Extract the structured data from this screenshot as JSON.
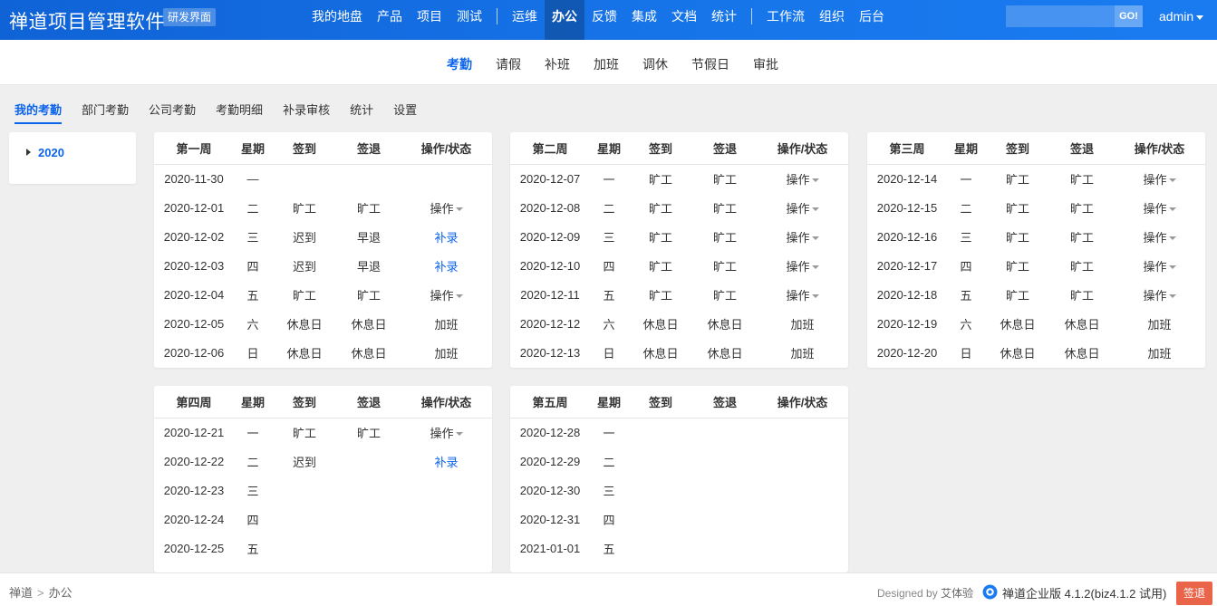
{
  "header": {
    "brand": "禅道项目管理软件",
    "badge": "研发界面",
    "nav_group1": [
      "我的地盘",
      "产品",
      "项目",
      "测试"
    ],
    "nav_group2": [
      "运维",
      "办公",
      "反馈",
      "集成",
      "文档",
      "统计"
    ],
    "nav_group3": [
      "工作流",
      "组织",
      "后台"
    ],
    "active_nav": "办公",
    "search": {
      "placeholder": "",
      "button": "GO!"
    },
    "user": "admin"
  },
  "subnav": {
    "items": [
      "考勤",
      "请假",
      "补班",
      "加班",
      "调休",
      "节假日",
      "审批"
    ],
    "active": "考勤"
  },
  "tabs": {
    "items": [
      "我的考勤",
      "部门考勤",
      "公司考勤",
      "考勤明细",
      "补录审核",
      "统计",
      "设置"
    ],
    "active": "我的考勤"
  },
  "year_list": {
    "year": "2020"
  },
  "colors": {
    "absent": "#f1a325",
    "late": "#f05c45",
    "early_leave": "#e5572d",
    "rest": "#3280fc",
    "link": "#0c64eb",
    "primary": "#0c64eb",
    "danger": "#ea644a"
  },
  "table_headers": {
    "day": "星期",
    "sign_in": "签到",
    "sign_out": "签退",
    "action": "操作/状态"
  },
  "weeks": [
    {
      "title": "第一周",
      "rows": [
        {
          "date": "2020-11-30",
          "day": "一",
          "in": "",
          "out": "",
          "action": "",
          "muted": true
        },
        {
          "date": "2020-12-01",
          "day": "二",
          "in": "旷工",
          "out": "旷工",
          "action": "操作"
        },
        {
          "date": "2020-12-02",
          "day": "三",
          "in": "迟到",
          "out": "早退",
          "action": "补录"
        },
        {
          "date": "2020-12-03",
          "day": "四",
          "in": "迟到",
          "out": "早退",
          "action": "补录"
        },
        {
          "date": "2020-12-04",
          "day": "五",
          "in": "旷工",
          "out": "旷工",
          "action": "操作"
        },
        {
          "date": "2020-12-05",
          "day": "六",
          "in": "休息日",
          "out": "休息日",
          "action": "加班"
        },
        {
          "date": "2020-12-06",
          "day": "日",
          "in": "休息日",
          "out": "休息日",
          "action": "加班"
        }
      ]
    },
    {
      "title": "第二周",
      "rows": [
        {
          "date": "2020-12-07",
          "day": "一",
          "in": "旷工",
          "out": "旷工",
          "action": "操作"
        },
        {
          "date": "2020-12-08",
          "day": "二",
          "in": "旷工",
          "out": "旷工",
          "action": "操作"
        },
        {
          "date": "2020-12-09",
          "day": "三",
          "in": "旷工",
          "out": "旷工",
          "action": "操作"
        },
        {
          "date": "2020-12-10",
          "day": "四",
          "in": "旷工",
          "out": "旷工",
          "action": "操作"
        },
        {
          "date": "2020-12-11",
          "day": "五",
          "in": "旷工",
          "out": "旷工",
          "action": "操作"
        },
        {
          "date": "2020-12-12",
          "day": "六",
          "in": "休息日",
          "out": "休息日",
          "action": "加班"
        },
        {
          "date": "2020-12-13",
          "day": "日",
          "in": "休息日",
          "out": "休息日",
          "action": "加班"
        }
      ]
    },
    {
      "title": "第三周",
      "rows": [
        {
          "date": "2020-12-14",
          "day": "一",
          "in": "旷工",
          "out": "旷工",
          "action": "操作"
        },
        {
          "date": "2020-12-15",
          "day": "二",
          "in": "旷工",
          "out": "旷工",
          "action": "操作"
        },
        {
          "date": "2020-12-16",
          "day": "三",
          "in": "旷工",
          "out": "旷工",
          "action": "操作"
        },
        {
          "date": "2020-12-17",
          "day": "四",
          "in": "旷工",
          "out": "旷工",
          "action": "操作"
        },
        {
          "date": "2020-12-18",
          "day": "五",
          "in": "旷工",
          "out": "旷工",
          "action": "操作"
        },
        {
          "date": "2020-12-19",
          "day": "六",
          "in": "休息日",
          "out": "休息日",
          "action": "加班"
        },
        {
          "date": "2020-12-20",
          "day": "日",
          "in": "休息日",
          "out": "休息日",
          "action": "加班"
        }
      ]
    },
    {
      "title": "第四周",
      "rows": [
        {
          "date": "2020-12-21",
          "day": "一",
          "in": "旷工",
          "out": "旷工",
          "action": "操作"
        },
        {
          "date": "2020-12-22",
          "day": "二",
          "in": "迟到",
          "out": "",
          "action": "补录"
        },
        {
          "date": "2020-12-23",
          "day": "三",
          "in": "",
          "out": "",
          "action": ""
        },
        {
          "date": "2020-12-24",
          "day": "四",
          "in": "",
          "out": "",
          "action": ""
        },
        {
          "date": "2020-12-25",
          "day": "五",
          "in": "",
          "out": "",
          "action": ""
        }
      ]
    },
    {
      "title": "第五周",
      "rows": [
        {
          "date": "2020-12-28",
          "day": "一",
          "in": "",
          "out": "",
          "action": ""
        },
        {
          "date": "2020-12-29",
          "day": "二",
          "in": "",
          "out": "",
          "action": ""
        },
        {
          "date": "2020-12-30",
          "day": "三",
          "in": "",
          "out": "",
          "action": ""
        },
        {
          "date": "2020-12-31",
          "day": "四",
          "in": "",
          "out": "",
          "action": ""
        },
        {
          "date": "2021-01-01",
          "day": "五",
          "in": "",
          "out": "",
          "action": "",
          "muted": true
        }
      ]
    }
  ],
  "footer": {
    "breadcrumb": [
      "禅道",
      "办公"
    ],
    "designed_by_label": "Designed by",
    "designer": "艾体验",
    "version": "禅道企业版 4.1.2(biz4.1.2 试用)",
    "signout": "签退"
  }
}
